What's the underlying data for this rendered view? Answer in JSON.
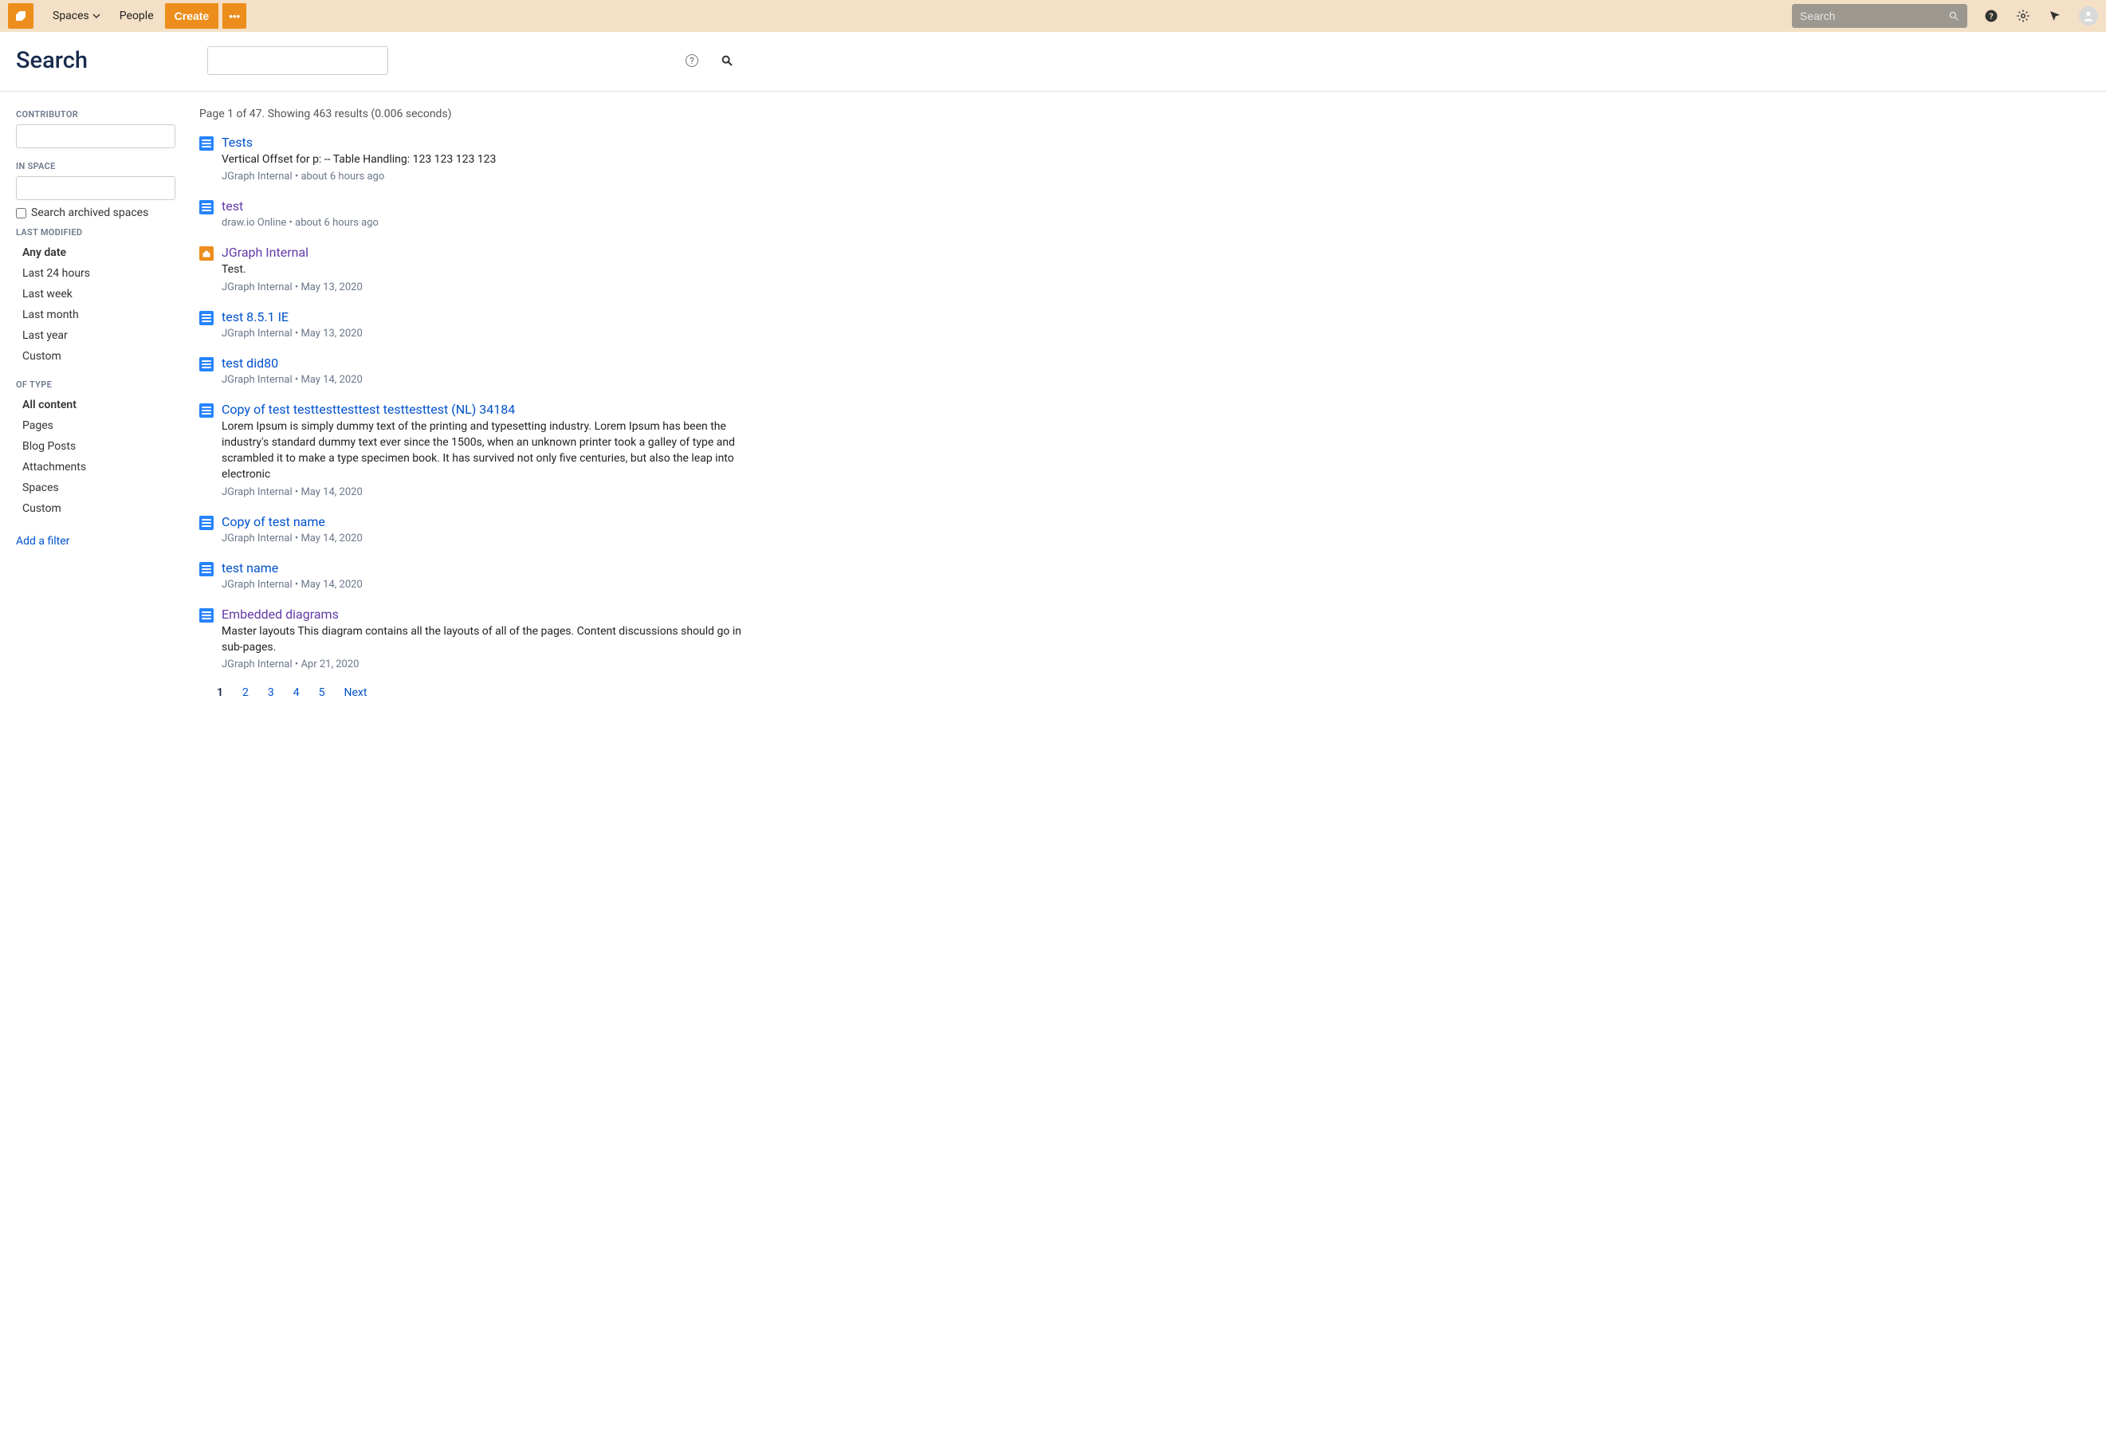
{
  "topnav": {
    "spaces": "Spaces",
    "people": "People",
    "create": "Create",
    "more": "•••",
    "search_placeholder": "Search"
  },
  "page_title": "Search",
  "big_search_help": "?",
  "filters": {
    "contributor": {
      "heading": "Contributor",
      "value": ""
    },
    "in_space": {
      "heading": "In space",
      "value": ""
    },
    "archived_cb": "Search archived spaces",
    "last_modified": {
      "heading": "Last modified",
      "items": [
        "Any date",
        "Last 24 hours",
        "Last week",
        "Last month",
        "Last year",
        "Custom"
      ]
    },
    "of_type": {
      "heading": "Of type",
      "items": [
        "All content",
        "Pages",
        "Blog Posts",
        "Attachments",
        "Spaces",
        "Custom"
      ]
    },
    "add_filter": "Add a filter"
  },
  "results_meta": "Page 1 of 47. Showing 463 results (0.006 seconds)",
  "results": [
    {
      "icon": "doc",
      "title": "Tests",
      "visited": false,
      "snippet": "Vertical Offset for p: -- Table Handling: 123 123 123 123",
      "space": "JGraph Internal",
      "date": "about 6 hours ago"
    },
    {
      "icon": "doc",
      "title": "test",
      "visited": true,
      "snippet": "",
      "space": "draw.io Online",
      "date": "about 6 hours ago"
    },
    {
      "icon": "home",
      "title": "JGraph Internal",
      "visited": true,
      "snippet": "Test.",
      "space": "JGraph Internal",
      "date": "May 13, 2020"
    },
    {
      "icon": "doc",
      "title": "test 8.5.1 IE",
      "visited": false,
      "snippet": "",
      "space": "JGraph Internal",
      "date": "May 13, 2020"
    },
    {
      "icon": "doc",
      "title": "test did80",
      "visited": false,
      "snippet": "",
      "space": "JGraph Internal",
      "date": "May 14, 2020"
    },
    {
      "icon": "doc",
      "title": "Copy of test testtesttesttest testtesttest (NL) 34184",
      "visited": false,
      "snippet": "Lorem Ipsum is simply dummy text of the printing and typesetting industry. Lorem Ipsum has been the industry's standard dummy text ever since the 1500s, when an unknown printer took a galley of type and scrambled it to make a type specimen book. It has survived not only five centuries, but also the leap into electronic",
      "space": "JGraph Internal",
      "date": "May 14, 2020"
    },
    {
      "icon": "doc",
      "title": "Copy of test name",
      "visited": false,
      "snippet": "",
      "space": "JGraph Internal",
      "date": "May 14, 2020"
    },
    {
      "icon": "doc",
      "title": "test name",
      "visited": false,
      "snippet": "",
      "space": "JGraph Internal",
      "date": "May 14, 2020"
    },
    {
      "icon": "doc",
      "title": "Embedded diagrams",
      "visited": true,
      "snippet": "Master layouts This diagram contains all the layouts of all of the pages. Content discussions should go in sub-pages.",
      "space": "JGraph Internal",
      "date": "Apr 21, 2020"
    }
  ],
  "pagination": {
    "pages": [
      "1",
      "2",
      "3",
      "4",
      "5"
    ],
    "next": "Next"
  }
}
